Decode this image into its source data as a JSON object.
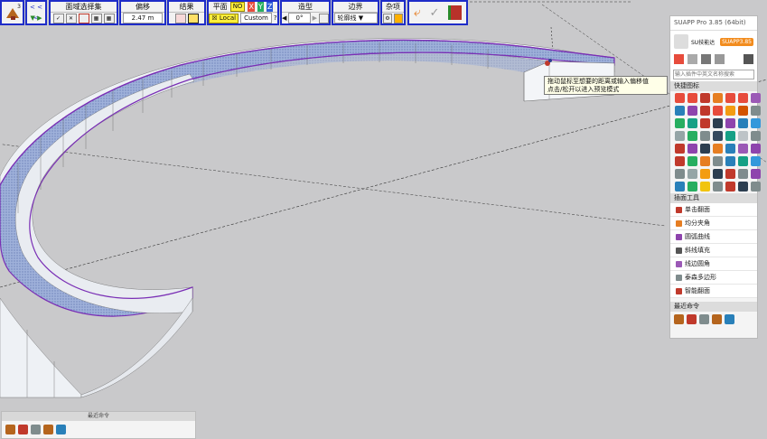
{
  "toolbar": {
    "g1": {
      "badge": "3"
    },
    "g2": {
      "top": "< < <",
      "bottom": "▼ ▶"
    },
    "g3": {
      "title": "面域选择集"
    },
    "g4": {
      "title": "偏移",
      "value": "2.47 m"
    },
    "g5": {
      "title": "结果"
    },
    "g6": {
      "title": "平面",
      "no": "NO",
      "x": "X",
      "y": "Y",
      "z": "Z",
      "local": "Local",
      "custom": "Custom",
      "q": "?"
    },
    "g7": {
      "title": "造型",
      "angle": "0°"
    },
    "g8": {
      "title": "边界",
      "value": "轮廓线"
    },
    "g9": {
      "title": "杂项"
    }
  },
  "tooltip": {
    "line1": "拖动鼠标至想要的距离或输入偏移值",
    "line2": "点击/松开以进入预览模式"
  },
  "panel": {
    "title": "SUAPP Pro 3.85 (64bit)",
    "user": "SU技能达",
    "badge": "SUAPP3.85",
    "search_placeholder": "输入插件中英文名称搜索",
    "quick_title": "快捷图标",
    "tools_title": "插面工具",
    "tools": [
      {
        "label": "单击翻面",
        "color": "#c0392b"
      },
      {
        "label": "均分夹角",
        "color": "#e67e22"
      },
      {
        "label": "圆弧曲线",
        "color": "#8e44ad"
      },
      {
        "label": "斜线填充",
        "color": "#555555"
      },
      {
        "label": "线边圆角",
        "color": "#9b59b6"
      },
      {
        "label": "泰森多边形",
        "color": "#7f8c8d"
      },
      {
        "label": "智能翻面",
        "color": "#c0392b"
      }
    ],
    "recent_title": "最近命令"
  },
  "mini": {
    "title": "最近命令"
  },
  "colors": {
    "toolbar_border": "#1e2cc8",
    "selection": "#7a2fb5",
    "face_fill": "#8aa1d6",
    "wall": "#f4f6f8",
    "background": "#c9c9cb"
  }
}
